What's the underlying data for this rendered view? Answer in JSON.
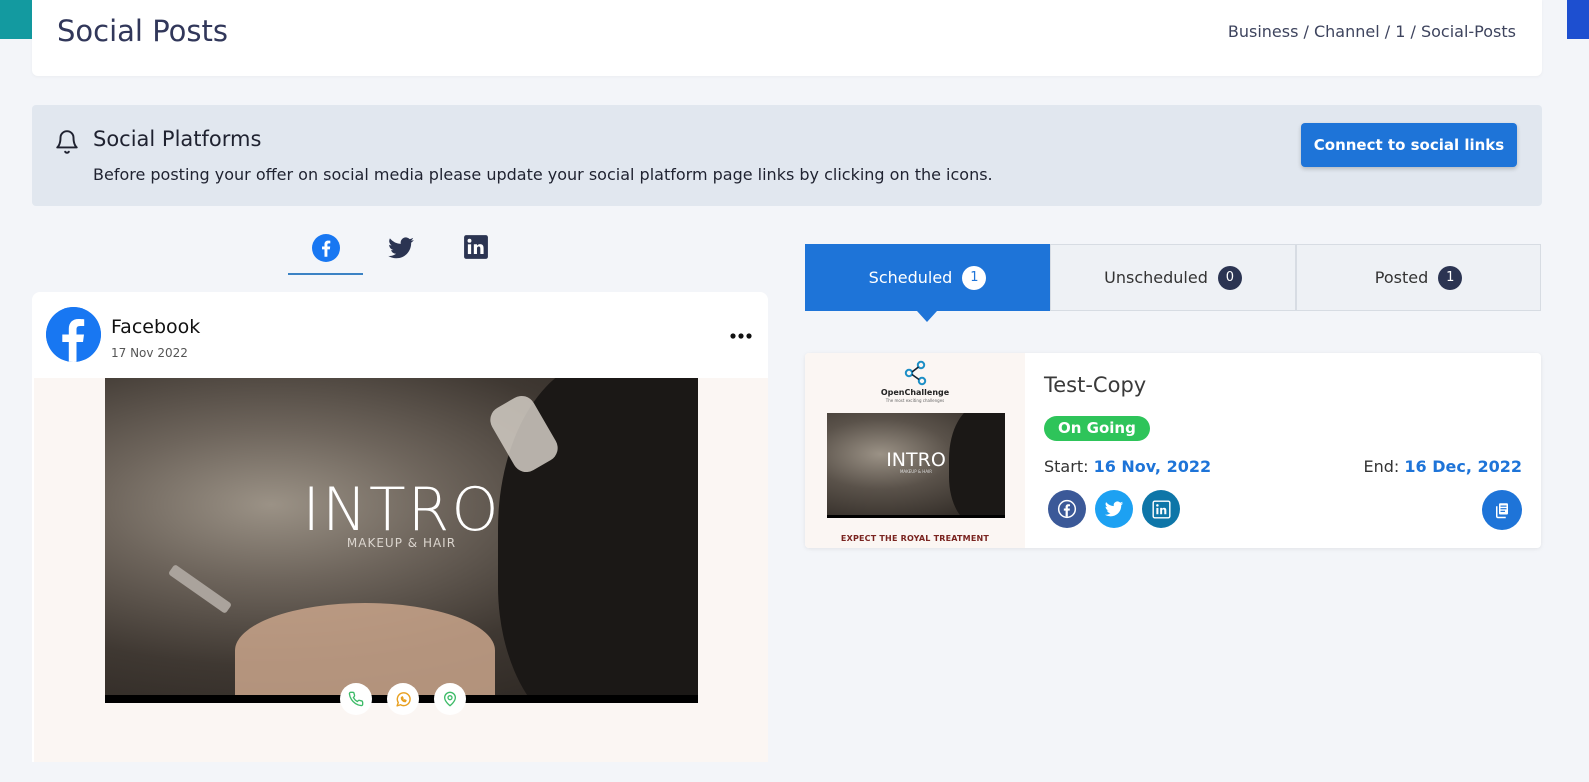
{
  "header": {
    "title": "Social Posts",
    "breadcrumb": "Business / Channel / 1 / Social-Posts"
  },
  "alert": {
    "icon": "bell-icon",
    "title": "Social Platforms",
    "text": "Before posting your offer on social media please update your social platform page links by clicking on the icons.",
    "button_label": "Connect to social links"
  },
  "platform_tabs": [
    {
      "icon": "facebook-icon",
      "active": true
    },
    {
      "icon": "twitter-icon",
      "active": false
    },
    {
      "icon": "linkedin-icon",
      "active": false
    }
  ],
  "post": {
    "name": "Facebook",
    "date": "17 Nov 2022",
    "image_title": "INTRO",
    "image_subtitle": "MAKEUP & HAIR",
    "contact_icons": [
      "phone-icon",
      "whatsapp-icon",
      "location-icon"
    ]
  },
  "status_tabs": [
    {
      "label": "Scheduled",
      "count": "1",
      "active": true
    },
    {
      "label": "Unscheduled",
      "count": "0",
      "active": false
    },
    {
      "label": "Posted",
      "count": "1",
      "active": false
    }
  ],
  "offer": {
    "thumb_brand": "OpenChallenge",
    "thumb_tagline": "The most exciting challenges",
    "thumb_title": "INTRO",
    "thumb_subtitle": "MAKEUP & HAIR",
    "thumb_footer": "EXPECT THE ROYAL TREATMENT",
    "title": "Test-Copy",
    "status": "On Going",
    "start_label": "Start:",
    "start_date": "16 Nov, 2022",
    "end_label": "End:",
    "end_date": "16 Dec, 2022",
    "share_icons": [
      "facebook-icon",
      "twitter-icon",
      "linkedin-icon"
    ],
    "copy_icon": "copy-icon"
  },
  "colors": {
    "primary": "#1e74d8",
    "badge_green": "#2ec45a",
    "facebook": "#3b5998",
    "twitter": "#1da1f2",
    "linkedin": "#0e76a8",
    "count_badge": "#2b3452"
  }
}
